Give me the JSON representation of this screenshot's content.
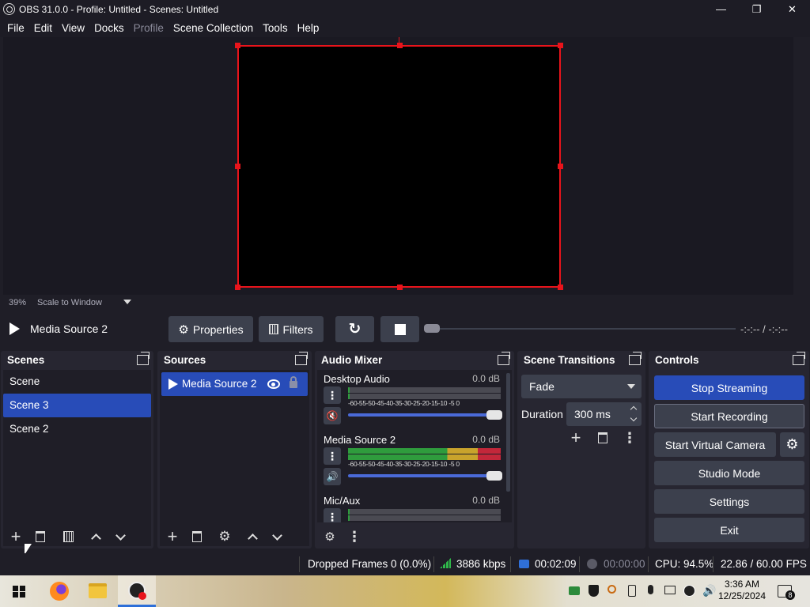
{
  "window": {
    "title": "OBS 31.0.0 - Profile: Untitled - Scenes: Untitled",
    "minimize": "—",
    "restore": "❐",
    "close": "✕"
  },
  "menu": [
    "File",
    "Edit",
    "View",
    "Docks",
    "Profile",
    "Scene Collection",
    "Tools",
    "Help"
  ],
  "preview": {
    "zoom": "39%",
    "scale_mode": "Scale to Window"
  },
  "source_toolbar": {
    "source_name": "Media Source 2",
    "properties": "Properties",
    "filters": "Filters",
    "time": "-:-:-- / -:-:--"
  },
  "scenes": {
    "title": "Scenes",
    "items": [
      "Scene",
      "Scene 3",
      "Scene 2"
    ],
    "selected": "Scene 3"
  },
  "sources": {
    "title": "Sources",
    "items": [
      "Media Source 2"
    ]
  },
  "mixer": {
    "title": "Audio Mixer",
    "scale": "-60-55-50-45-40-35-30-25-20-15-10 -5  0",
    "channels": [
      {
        "name": "Desktop Audio",
        "db": "0.0 dB",
        "muted": true,
        "level": 0
      },
      {
        "name": "Media Source 2",
        "db": "0.0 dB",
        "muted": false,
        "level": 1.0
      },
      {
        "name": "Mic/Aux",
        "db": "0.0 dB",
        "muted": false,
        "level": 0
      }
    ]
  },
  "transitions": {
    "title": "Scene Transitions",
    "selected": "Fade",
    "duration_label": "Duration",
    "duration_value": "300 ms"
  },
  "controls": {
    "title": "Controls",
    "stop_streaming": "Stop Streaming",
    "start_recording": "Start Recording",
    "start_virtual_camera": "Start Virtual Camera",
    "studio_mode": "Studio Mode",
    "settings": "Settings",
    "exit": "Exit"
  },
  "status": {
    "dropped_frames": "Dropped Frames 0 (0.0%)",
    "bitrate": "3886 kbps",
    "stream_time": "00:02:09",
    "record_time": "00:00:00",
    "cpu": "CPU: 94.5%",
    "fps": "22.86 / 60.00 FPS"
  },
  "taskbar": {
    "time": "3:36 AM",
    "date": "12/25/2024",
    "notification_count": "8"
  },
  "colors": {
    "accent": "#284cb8",
    "selection_border": "#e8141b",
    "panel": "#272631",
    "background": "#1f1e27"
  }
}
